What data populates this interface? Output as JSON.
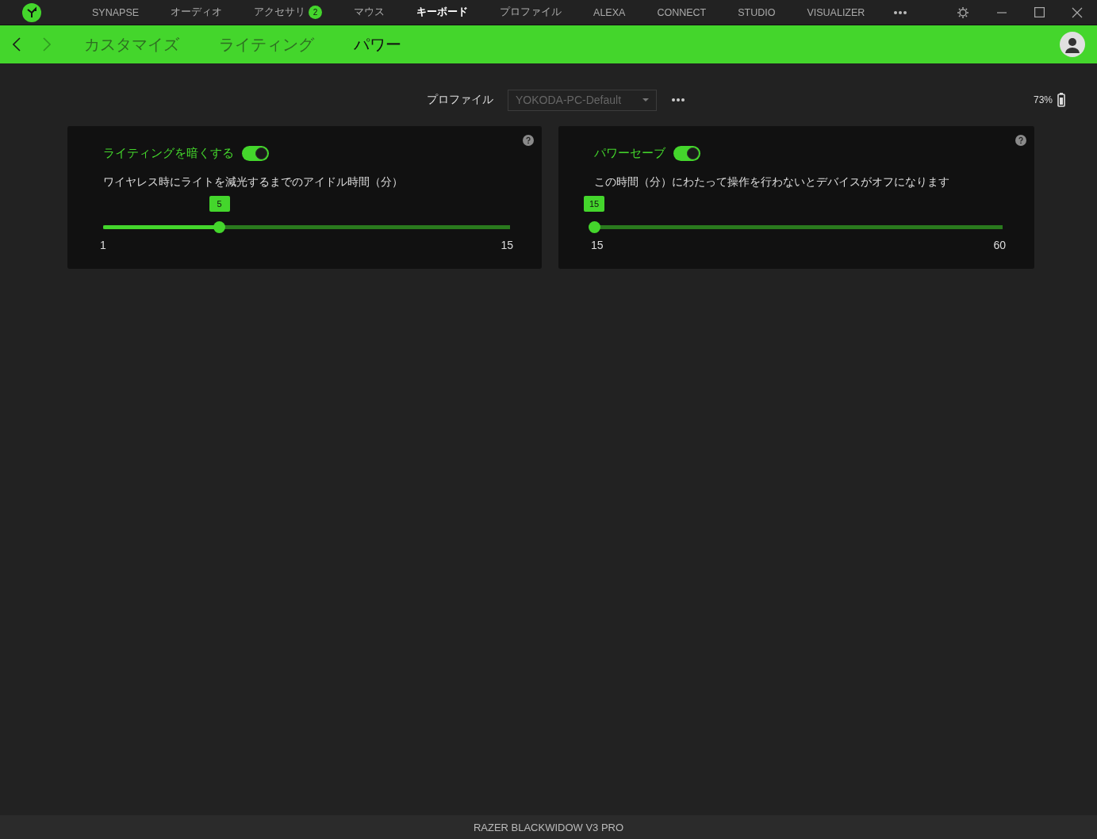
{
  "nav_tabs": [
    {
      "label": "SYNAPSE",
      "selected": false
    },
    {
      "label": "オーディオ",
      "selected": false
    },
    {
      "label": "アクセサリ",
      "selected": false,
      "badge": "2"
    },
    {
      "label": "マウス",
      "selected": false
    },
    {
      "label": "キーボード",
      "selected": true
    },
    {
      "label": "プロファイル",
      "selected": false
    },
    {
      "label": "ALEXA",
      "selected": false
    },
    {
      "label": "CONNECT",
      "selected": false
    },
    {
      "label": "STUDIO",
      "selected": false
    },
    {
      "label": "VISUALIZER",
      "selected": false
    }
  ],
  "sub_tabs": [
    {
      "label": "カスタマイズ",
      "selected": false
    },
    {
      "label": "ライティング",
      "selected": false
    },
    {
      "label": "パワー",
      "selected": true
    }
  ],
  "profile": {
    "label": "プロファイル",
    "value": "YOKODA-PC-Default"
  },
  "battery": {
    "reading": "73%"
  },
  "cards": [
    {
      "title": "ライティングを暗くする",
      "on": true,
      "description": "ワイヤレス時にライトを減光するまでのアイドル時間（分）",
      "value": "5",
      "level": 0.2857,
      "min": "1",
      "max": "15"
    },
    {
      "title": "パワーセーブ",
      "on": true,
      "description": "この時間（分）にわたって操作を行わないとデバイスがオフになります",
      "value": "15",
      "level": 0,
      "min": "15",
      "max": "60"
    }
  ],
  "status_bar": "RAZER BLACKWIDOW V3 PRO"
}
